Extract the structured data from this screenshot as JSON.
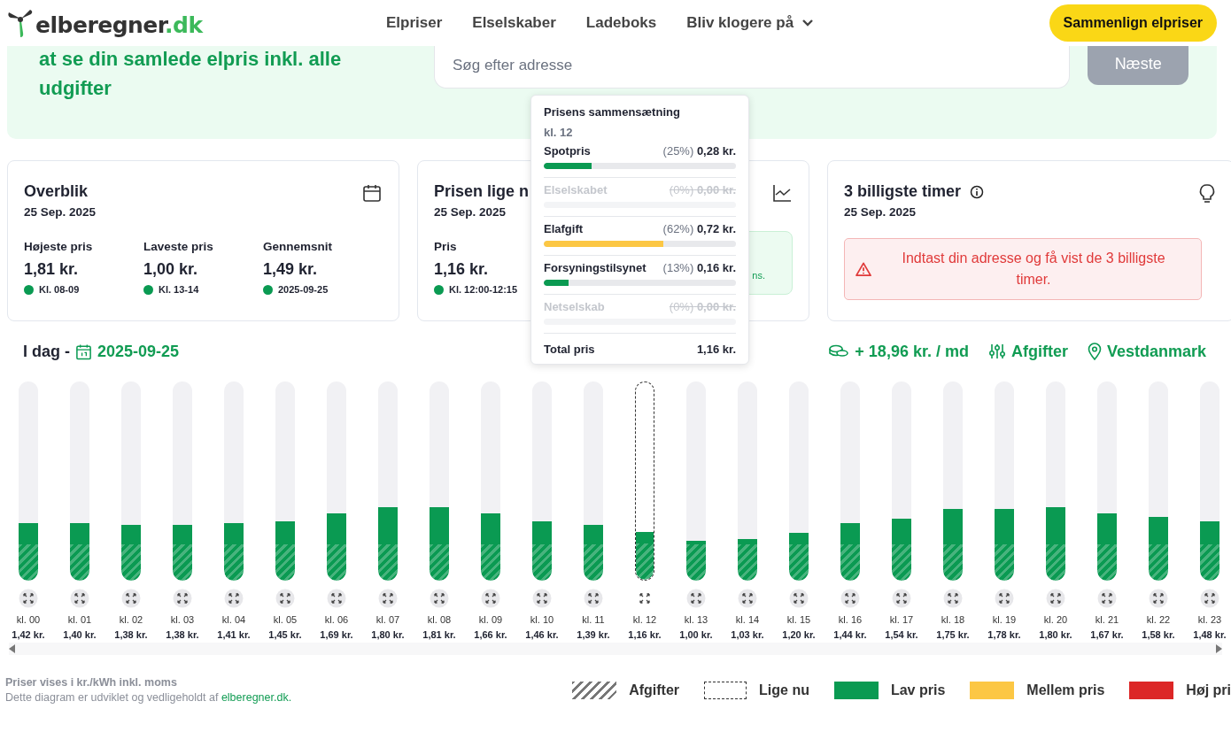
{
  "logo": {
    "name": "elberegner",
    "tld": ".dk"
  },
  "nav": [
    {
      "label": "Elpriser",
      "dropdown": false
    },
    {
      "label": "Elselskaber",
      "dropdown": false
    },
    {
      "label": "Ladeboks",
      "dropdown": false
    },
    {
      "label": "Bliv klogere på",
      "dropdown": true
    }
  ],
  "cta": "Sammenlign elpriser",
  "hero": {
    "text": "at se din samlede elpris inkl. alle udgifter",
    "search": {
      "placeholder": "Søg efter adresse"
    },
    "next_button": {
      "label": "Næste",
      "disabled": true
    }
  },
  "overview": {
    "title": "Overblik",
    "date": "25 Sep. 2025",
    "stats": [
      {
        "label": "Højeste pris",
        "value": "1,81 kr.",
        "note": "Kl. 08-09",
        "color": "#0a9a52"
      },
      {
        "label": "Laveste pris",
        "value": "1,00 kr.",
        "note": "Kl. 13-14",
        "color": "#0a9a52"
      },
      {
        "label": "Gennemsnit",
        "value": "1,49 kr.",
        "note": "2025-09-25",
        "color": "#0a9a52"
      }
    ]
  },
  "current": {
    "title": "Prisen lige n",
    "date": "25 Sep. 2025",
    "label": "Pris",
    "value": "1,16 kr.",
    "note": "Kl. 12:00-12:15",
    "color": "#0a9a52",
    "info_text": "ns."
  },
  "cheapest": {
    "title": "3 billigste timer",
    "date": "25 Sep. 2025",
    "alert": "Indtast din adresse og få vist de 3 billigste timer."
  },
  "tooltip": {
    "title": "Prisens sammensætning",
    "hour": "kl. 12",
    "rows": [
      {
        "name": "Spotpris",
        "share": "(25%)",
        "value": "0,28 kr.",
        "level": 0.25,
        "color": "#0a9a52",
        "disabled": false
      },
      {
        "name": "Elselskabet",
        "share": "(0%)",
        "value": "0,00 kr.",
        "disabled": true
      },
      {
        "name": "Elafgift",
        "share": "(62%)",
        "value": "0,72 kr.",
        "level": 0.62,
        "color": "#fcc744",
        "disabled": false
      },
      {
        "name": "Forsyningstilsynet",
        "share": "(13%)",
        "value": "0,16 kr.",
        "level": 0.13,
        "color": "#0a9a52",
        "disabled": false
      },
      {
        "name": "Netselskab",
        "share": "(0%)",
        "value": "0,00 kr.",
        "disabled": true
      }
    ],
    "total_label": "Total pris",
    "total_value": "1,16 kr."
  },
  "chart_header": {
    "prefix": "I dag -",
    "date": "2025-09-25",
    "savings": "+ 18,96 kr. / md",
    "fees": "Afgifter",
    "region": "Vestdanmark"
  },
  "hours": [
    {
      "label": "kl. 00",
      "price": "1,42 kr.",
      "level": 0.29,
      "current": false
    },
    {
      "label": "kl. 01",
      "price": "1,40 kr.",
      "level": 0.29,
      "current": false
    },
    {
      "label": "kl. 02",
      "price": "1,38 kr.",
      "level": 0.28,
      "current": false
    },
    {
      "label": "kl. 03",
      "price": "1,38 kr.",
      "level": 0.28,
      "current": false
    },
    {
      "label": "kl. 04",
      "price": "1,41 kr.",
      "level": 0.29,
      "current": false
    },
    {
      "label": "kl. 05",
      "price": "1,45 kr.",
      "level": 0.3,
      "current": false
    },
    {
      "label": "kl. 06",
      "price": "1,69 kr.",
      "level": 0.34,
      "current": false
    },
    {
      "label": "kl. 07",
      "price": "1,80 kr.",
      "level": 0.37,
      "current": false
    },
    {
      "label": "kl. 08",
      "price": "1,81 kr.",
      "level": 0.37,
      "current": false
    },
    {
      "label": "kl. 09",
      "price": "1,66 kr.",
      "level": 0.34,
      "current": false
    },
    {
      "label": "kl. 10",
      "price": "1,46 kr.",
      "level": 0.3,
      "current": false
    },
    {
      "label": "kl. 11",
      "price": "1,39 kr.",
      "level": 0.28,
      "current": false
    },
    {
      "label": "kl. 12",
      "price": "1,16 kr.",
      "level": 0.24,
      "current": true
    },
    {
      "label": "kl. 13",
      "price": "1,00 kr.",
      "level": 0.2,
      "current": false
    },
    {
      "label": "kl. 14",
      "price": "1,03 kr.",
      "level": 0.21,
      "current": false
    },
    {
      "label": "kl. 15",
      "price": "1,20 kr.",
      "level": 0.24,
      "current": false
    },
    {
      "label": "kl. 16",
      "price": "1,44 kr.",
      "level": 0.29,
      "current": false
    },
    {
      "label": "kl. 17",
      "price": "1,54 kr.",
      "level": 0.31,
      "current": false
    },
    {
      "label": "kl. 18",
      "price": "1,75 kr.",
      "level": 0.36,
      "current": false
    },
    {
      "label": "kl. 19",
      "price": "1,78 kr.",
      "level": 0.36,
      "current": false
    },
    {
      "label": "kl. 20",
      "price": "1,80 kr.",
      "level": 0.37,
      "current": false
    },
    {
      "label": "kl. 21",
      "price": "1,67 kr.",
      "level": 0.34,
      "current": false
    },
    {
      "label": "kl. 22",
      "price": "1,58 kr.",
      "level": 0.32,
      "current": false
    },
    {
      "label": "kl. 23",
      "price": "1,48 kr.",
      "level": 0.3,
      "current": false
    }
  ],
  "footer": {
    "unit_note": "Priser vises i kr./kWh inkl. moms",
    "credit": "Dette diagram er udviklet og vedligeholdt af",
    "credit_link": "elberegner.dk."
  },
  "legend": [
    {
      "kind": "hatch",
      "label": "Afgifter"
    },
    {
      "kind": "dashed",
      "label": "Lige nu"
    },
    {
      "kind": "swatch",
      "label": "Lav pris",
      "color": "#0a9a52"
    },
    {
      "kind": "swatch",
      "label": "Mellem pris",
      "color": "#fcc744"
    },
    {
      "kind": "swatch",
      "label": "Høj pri",
      "color": "#dc2626"
    }
  ]
}
